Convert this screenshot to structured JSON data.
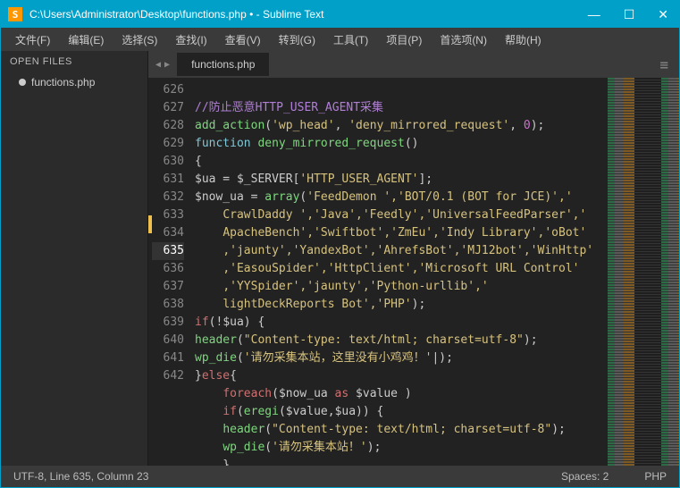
{
  "titlebar": {
    "title": "C:\\Users\\Administrator\\Desktop\\functions.php • - Sublime Text"
  },
  "window": {
    "min": "—",
    "max": "☐",
    "close": "✕"
  },
  "menu": {
    "file": "文件(F)",
    "edit": "编辑(E)",
    "select": "选择(S)",
    "find": "查找(I)",
    "view": "查看(V)",
    "goto": "转到(G)",
    "tools": "工具(T)",
    "project": "项目(P)",
    "prefs": "首选项(N)",
    "help": "帮助(H)"
  },
  "sidebar": {
    "header": "OPEN FILES",
    "files": [
      {
        "name": "functions.php"
      }
    ]
  },
  "tabs": {
    "prev": "◀",
    "next": "▶",
    "active": "functions.php",
    "menu": "≡"
  },
  "gutter": {
    "start": 626,
    "end": 642,
    "active": 635
  },
  "code": {
    "l626": "",
    "l627": "//防止恶意HTTP_USER_AGENT采集",
    "l628": {
      "fn": "add_action",
      "a1": "'wp_head'",
      "a2": "'deny_mirrored_request'",
      "a3": "0"
    },
    "l629": {
      "kw": "function",
      "name": "deny_mirrored_request",
      "paren": "()"
    },
    "l630": "{",
    "l631": {
      "var": "$ua",
      "eq": " = ",
      "srv": "$_SERVER",
      "key": "'HTTP_USER_AGENT'"
    },
    "l632": {
      "var": "$now_ua",
      "eq": " = ",
      "fn": "array",
      "row1": "'FeedDemon ','BOT/0.1 (BOT for JCE)','",
      "row2": "CrawlDaddy ','Java','Feedly','UniversalFeedParser','",
      "row3": "ApacheBench','Swiftbot','ZmEu','Indy Library','oBot'",
      "row4": ",'jaunty','YandexBot','AhrefsBot','MJ12bot','WinHttp'",
      "row5": ",'EasouSpider','HttpClient','Microsoft URL Control'",
      "row6": ",'YYSpider','jaunty','Python-urllib','",
      "row7": "lightDeckReports Bot','PHP'"
    },
    "l633": {
      "kw": "if",
      "op": "(!",
      "var": "$ua",
      "close": ") {"
    },
    "l634": {
      "fn": "header",
      "str": "\"Content-type: text/html; charset=utf-8\""
    },
    "l635": {
      "fn": "wp_die",
      "str": "'请勿采集本站，这里没有小鸡鸡！'",
      "cursor": true
    },
    "l636": {
      "close": "}",
      "kw": "else",
      "open": "{"
    },
    "l637": {
      "kw": "foreach",
      "p1": "(",
      "v1": "$now_ua",
      "as": " as ",
      "v2": "$value",
      "p2": " )"
    },
    "l638": {
      "kw": "if",
      "p1": "(",
      "fn": "eregi",
      "v1": "$value",
      "v2": "$ua",
      "p2": ")) {"
    },
    "l639": {
      "fn": "header",
      "str": "\"Content-type: text/html; charset=utf-8\""
    },
    "l640": {
      "fn": "wp_die",
      "str": "'请勿采集本站！'"
    },
    "l641": "}",
    "l642": "}"
  },
  "status": {
    "left": "UTF-8, Line 635, Column 23",
    "spaces": "Spaces: 2",
    "lang": "PHP"
  }
}
